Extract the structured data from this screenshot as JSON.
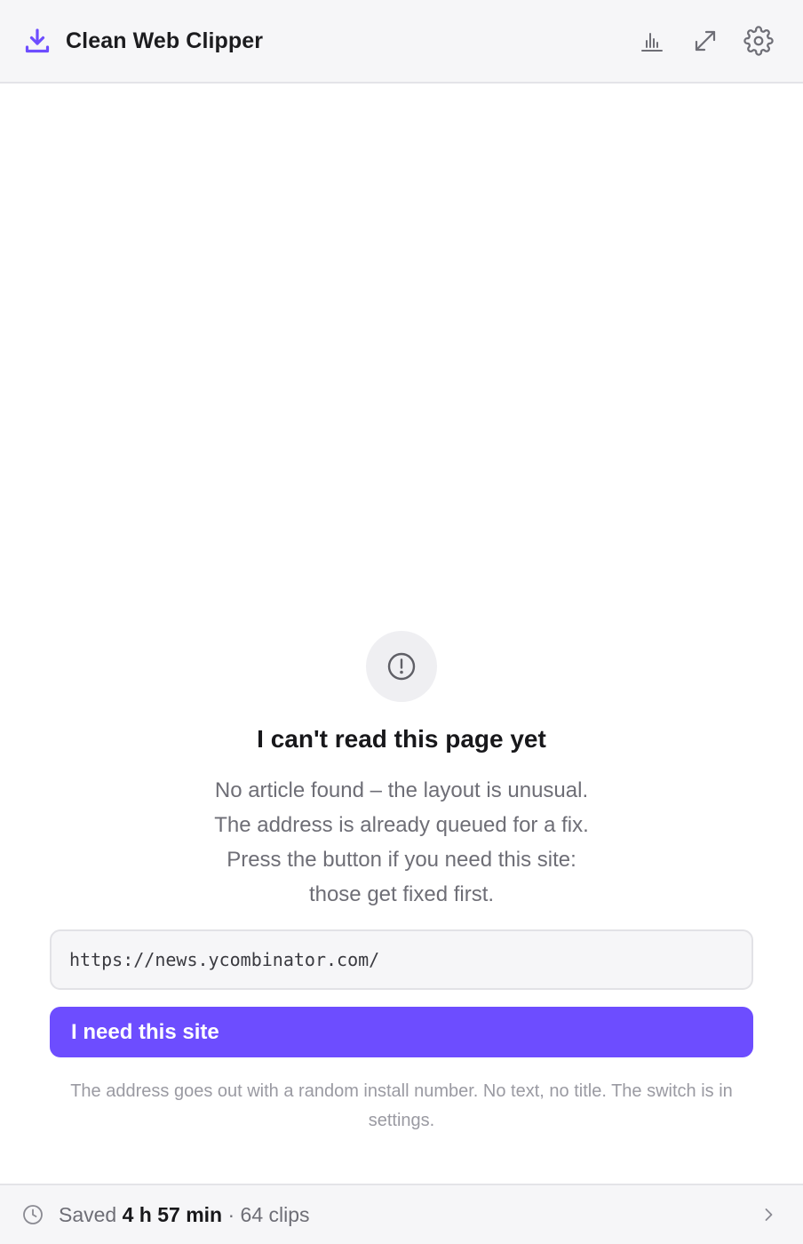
{
  "header": {
    "title": "Clean Web Clipper",
    "brand_icon": "download-tray-icon",
    "actions": [
      {
        "name": "stats",
        "icon": "bar-chart-icon"
      },
      {
        "name": "expand",
        "icon": "expand-arrows-icon"
      },
      {
        "name": "settings",
        "icon": "gear-icon"
      }
    ],
    "accent_color": "#6d4dff"
  },
  "status": {
    "icon": "alert-circle-icon",
    "title": "I can't read this page yet",
    "lines": [
      "No article found – the layout is unusual.",
      "The address is already queued for a fix.",
      "Press the button if you need this site:",
      "those get fixed first."
    ],
    "url": "https://news.ycombinator.com/",
    "button_label": "I need this site",
    "privacy_note": "The address goes out with a random install number. No text, no title. The switch is in settings."
  },
  "footer": {
    "prefix": "Saved ",
    "time_saved": "4 h 57 min",
    "suffix": " · 64 clips",
    "icon": "clock-icon",
    "chevron": "chevron-right-icon"
  }
}
